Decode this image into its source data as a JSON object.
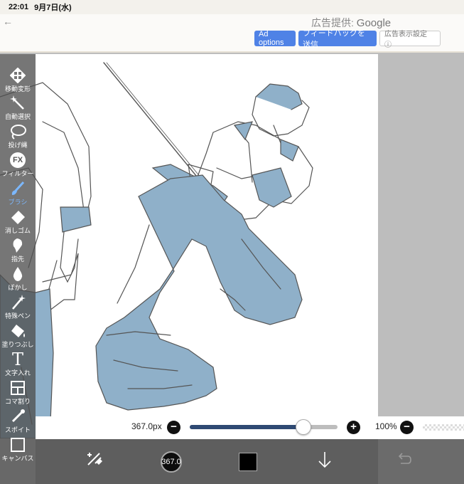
{
  "status": {
    "time": "22:01",
    "date": "9月7日(水)"
  },
  "ad": {
    "provider_prefix": "広告提供:",
    "provider_brand": "Google",
    "options_label": "Ad options",
    "feedback_label": "フィードバックを送信",
    "settings_label": "広告表示設定 ⓘ"
  },
  "tools": [
    {
      "label": "移動変形",
      "icon": "move-icon"
    },
    {
      "label": "自動選択",
      "icon": "magic-wand-icon"
    },
    {
      "label": "投げ縄",
      "icon": "lasso-icon"
    },
    {
      "label": "フィルター",
      "icon": "fx-icon",
      "glyph": "FX"
    },
    {
      "label": "ブラシ",
      "icon": "brush-icon",
      "active": true
    },
    {
      "label": "消しゴム",
      "icon": "eraser-icon"
    },
    {
      "label": "指先",
      "icon": "finger-icon"
    },
    {
      "label": "ぼかし",
      "icon": "blur-drop-icon"
    },
    {
      "label": "特殊ペン",
      "icon": "special-pen-icon"
    },
    {
      "label": "塗りつぶし",
      "icon": "bucket-icon"
    },
    {
      "label": "文字入れ",
      "icon": "text-icon",
      "glyph": "T"
    },
    {
      "label": "コマ割り",
      "icon": "frame-divide-icon"
    },
    {
      "label": "スポイト",
      "icon": "eyedropper-icon"
    },
    {
      "label": "キャンバス",
      "icon": "canvas-icon"
    }
  ],
  "brush": {
    "size_text": "367.0px",
    "size_fraction": 0.77,
    "circle_text": "367.0",
    "opacity_text": "100%"
  },
  "colors": {
    "accent": "#4f82e6",
    "slider_fill": "#2f4a73",
    "figure_blue": "#8fb0c9",
    "active_tool": "#7cb8ff"
  }
}
